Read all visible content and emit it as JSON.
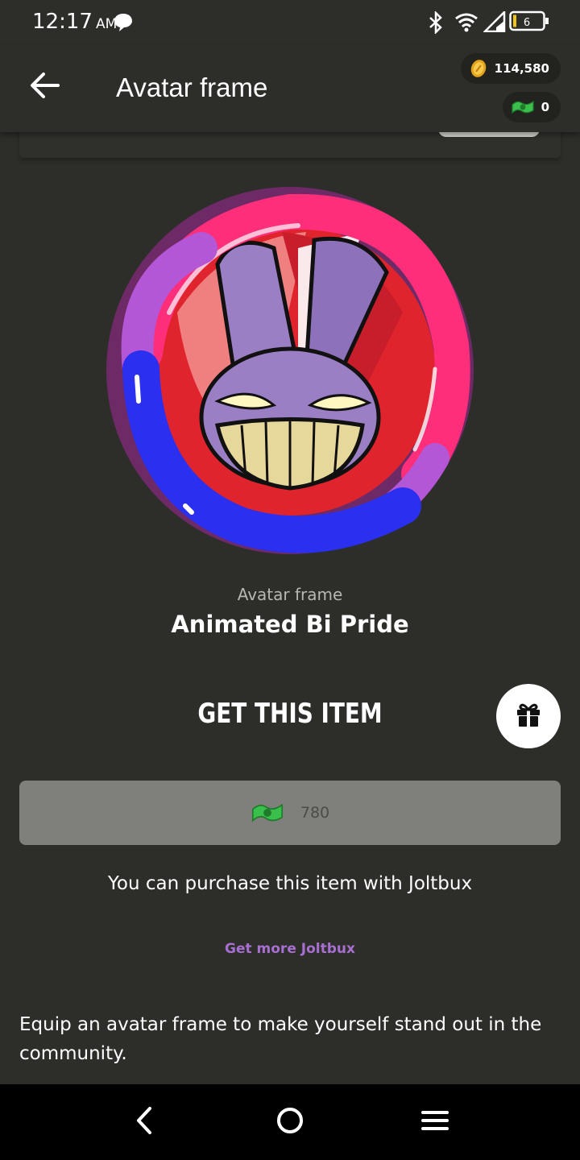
{
  "status_bar": {
    "time": "12:17",
    "ampm": "AM",
    "battery_level": "6",
    "icons": [
      "chat-bubble-icon",
      "bluetooth-icon",
      "wifi-icon",
      "signal-icon",
      "battery-icon"
    ]
  },
  "header": {
    "title": "Avatar frame",
    "coins": "114,580",
    "joltbux": "0"
  },
  "item": {
    "category": "Avatar frame",
    "name": "Animated Bi Pride",
    "frame_colors": [
      "#ff2e7a",
      "#b357d6",
      "#2b2ff0",
      "#7a2a6e"
    ]
  },
  "purchase": {
    "heading": "GET THIS ITEM",
    "price": "780",
    "note": "You can purchase this item with Joltbux",
    "get_more": "Get more Joltbux"
  },
  "description": "Equip an avatar frame to make yourself stand out in the community.",
  "colors": {
    "background": "#2d2e2a",
    "price_button": "#7f807c",
    "link": "#a66fd0"
  }
}
